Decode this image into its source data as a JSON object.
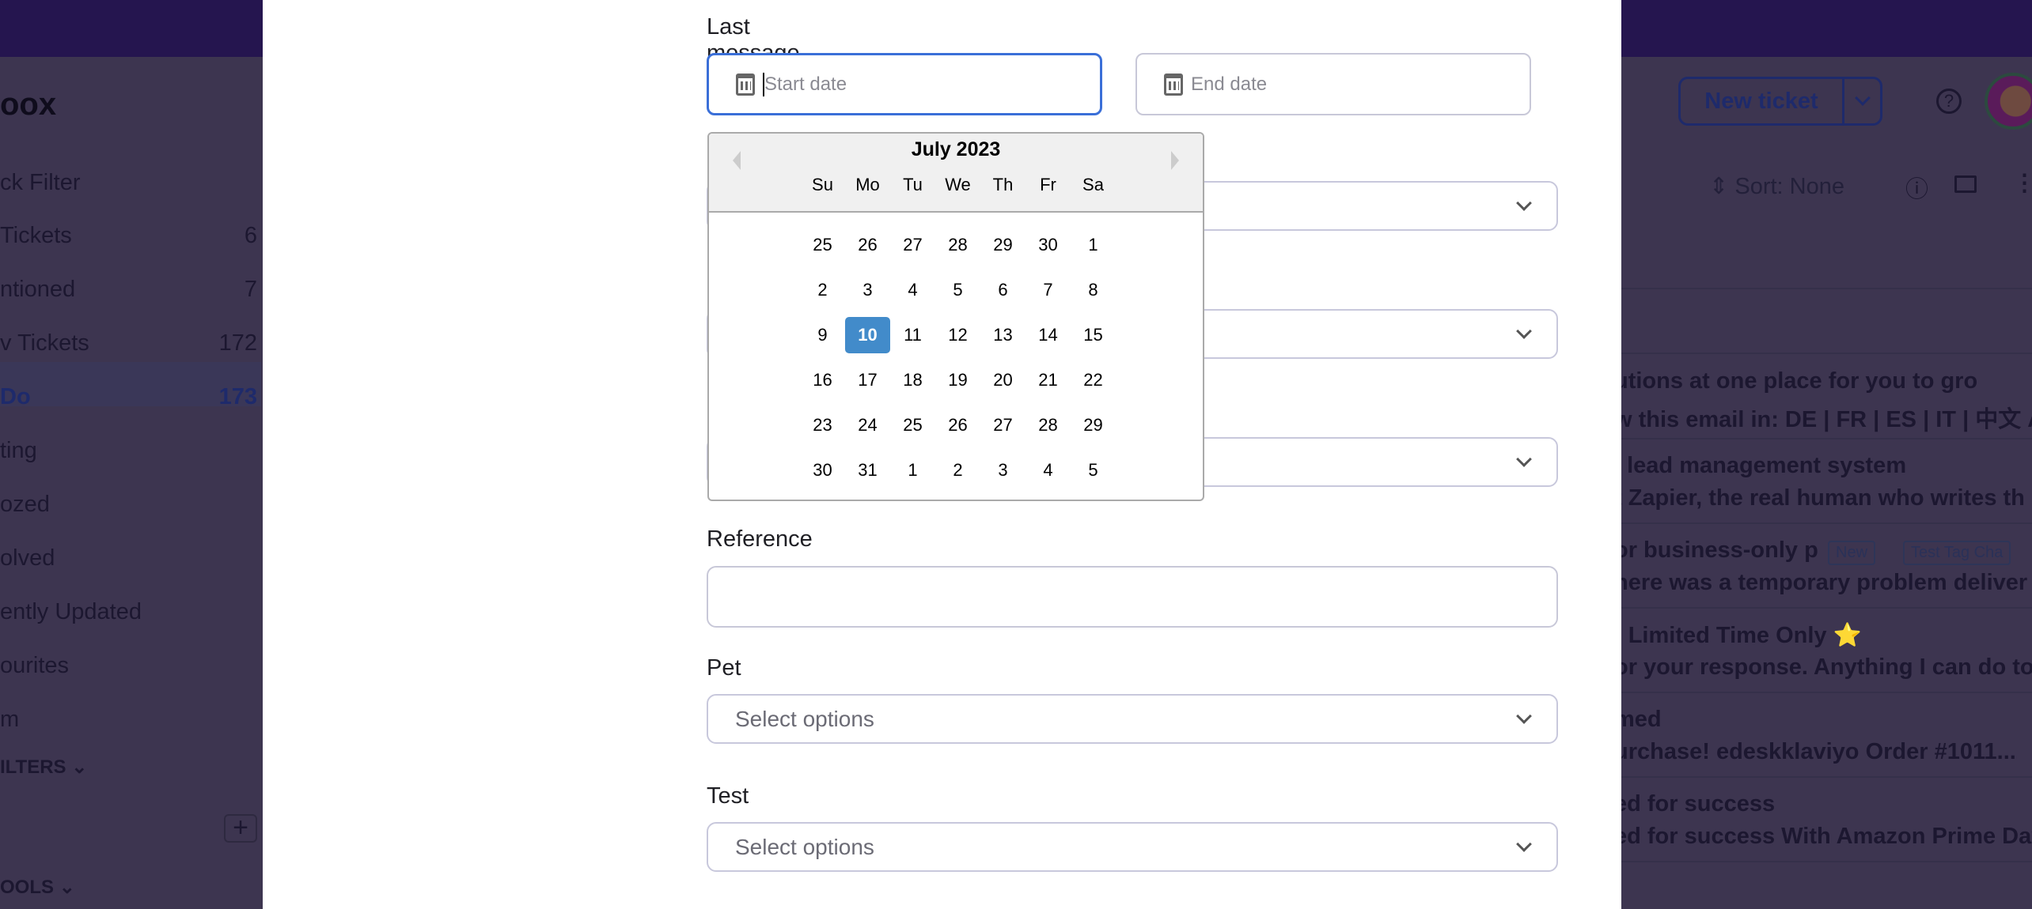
{
  "background": {
    "logo": "oox",
    "sidebar": [
      {
        "label": "ck Filter",
        "count": ""
      },
      {
        "label": "Tickets",
        "count": "6"
      },
      {
        "label": "ntioned",
        "count": "7"
      },
      {
        "label": "v Tickets",
        "count": "172"
      },
      {
        "label": "Do",
        "count": "173",
        "active": true
      },
      {
        "label": "ting",
        "count": ""
      },
      {
        "label": "ozed",
        "count": ""
      },
      {
        "label": "olved",
        "count": ""
      },
      {
        "label": "ently Updated",
        "count": ""
      },
      {
        "label": "ourites",
        "count": ""
      },
      {
        "label": "m",
        "count": ""
      }
    ],
    "filters_label": "ILTERS",
    "tools_label": "OOLS",
    "new_ticket": "New ticket",
    "sort": "Sort: None",
    "tickets": [
      {
        "subject": "utions at one place for you to gro",
        "preview": "w this email in: DE | FR | ES | IT | 中文 A"
      },
      {
        "subject": "l lead management system",
        "preview": "t Zapier, the real human who writes th"
      },
      {
        "subject": "or business-only p",
        "preview": "here was a temporary problem deliver",
        "tags": [
          "New",
          "Test Tag Cha"
        ]
      },
      {
        "subject": ": Limited Time Only ⭐",
        "preview": "or your response. Anything I can do to.."
      },
      {
        "subject": "med",
        "preview": "urchase! edeskklaviyo Order #1011..."
      },
      {
        "subject": "ed for success",
        "preview": "ed for success With Amazon Prime Day"
      }
    ]
  },
  "form": {
    "last_message_label": "Last message created at",
    "start_placeholder": "Start date",
    "end_placeholder": "End date",
    "reference_label": "Reference",
    "reference_value": "",
    "pet_label": "Pet",
    "pet_placeholder": "Select options",
    "test_label": "Test",
    "test_placeholder": "Select options"
  },
  "calendar": {
    "title": "July 2023",
    "days": [
      "Su",
      "Mo",
      "Tu",
      "We",
      "Th",
      "Fr",
      "Sa"
    ],
    "weeks": [
      [
        "25",
        "26",
        "27",
        "28",
        "29",
        "30",
        "1"
      ],
      [
        "2",
        "3",
        "4",
        "5",
        "6",
        "7",
        "8"
      ],
      [
        "9",
        "10",
        "11",
        "12",
        "13",
        "14",
        "15"
      ],
      [
        "16",
        "17",
        "18",
        "19",
        "20",
        "21",
        "22"
      ],
      [
        "23",
        "24",
        "25",
        "26",
        "27",
        "28",
        "29"
      ],
      [
        "30",
        "31",
        "1",
        "2",
        "3",
        "4",
        "5"
      ]
    ],
    "selected": "10",
    "selected_color": "#428bca"
  }
}
